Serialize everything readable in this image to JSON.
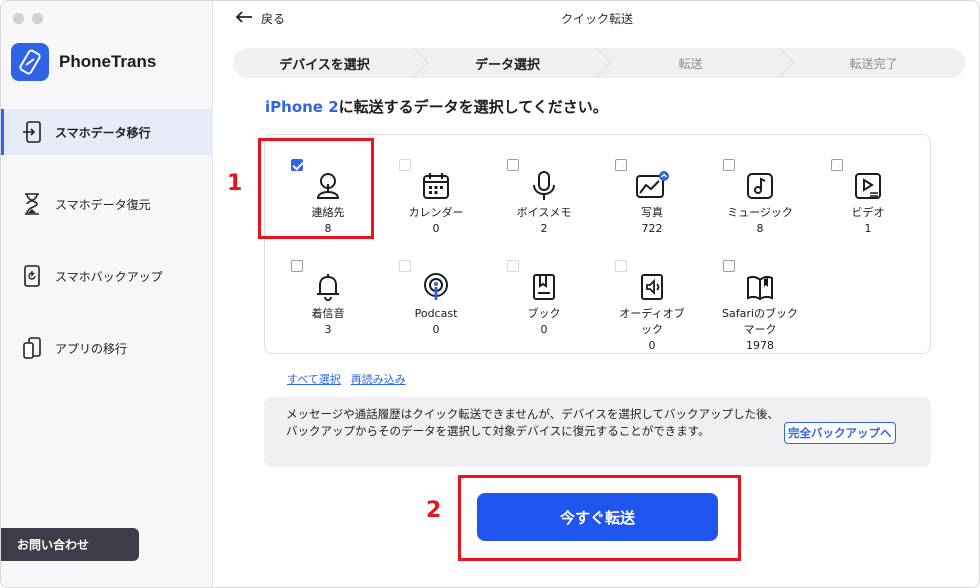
{
  "app": {
    "name": "PhoneTrans"
  },
  "sidebar": {
    "items": [
      {
        "label": "スマホデータ移行",
        "icon": "phone-transfer-icon",
        "active": true
      },
      {
        "label": "スマホデータ復元",
        "icon": "hourglass-icon",
        "active": false
      },
      {
        "label": "スマホバックアップ",
        "icon": "phone-backup-icon",
        "active": false
      },
      {
        "label": "アプリの移行",
        "icon": "app-transfer-icon",
        "active": false
      }
    ],
    "contact_label": "お問い合わせ"
  },
  "topbar": {
    "back_label": "戻る",
    "title": "クイック転送"
  },
  "steps": [
    {
      "label": "デバイスを選択",
      "state": "done"
    },
    {
      "label": "データ選択",
      "state": "done"
    },
    {
      "label": "転送",
      "state": "todo"
    },
    {
      "label": "転送完了",
      "state": "todo"
    }
  ],
  "headline": {
    "device": "iPhone 2",
    "text": "に転送するデータを選択してください。"
  },
  "categories": [
    {
      "label": "連絡先",
      "count": "8",
      "icon": "contacts-icon",
      "checked": true
    },
    {
      "label": "カレンダー",
      "count": "0",
      "icon": "calendar-icon",
      "checked": false
    },
    {
      "label": "ボイスメモ",
      "count": "2",
      "icon": "microphone-icon",
      "checked": false
    },
    {
      "label": "写真",
      "count": "722",
      "icon": "photos-icon",
      "checked": false
    },
    {
      "label": "ミュージック",
      "count": "8",
      "icon": "music-icon",
      "checked": false
    },
    {
      "label": "ビデオ",
      "count": "1",
      "icon": "video-icon",
      "checked": false
    },
    {
      "label": "着信音",
      "count": "3",
      "icon": "bell-icon",
      "checked": false
    },
    {
      "label": "Podcast",
      "count": "0",
      "icon": "podcast-icon",
      "checked": false
    },
    {
      "label": "ブック",
      "count": "0",
      "icon": "book-icon",
      "checked": false
    },
    {
      "label": "オーディオブック",
      "count": "0",
      "icon": "audiobook-icon",
      "checked": false
    },
    {
      "label": "Safariのブックマーク",
      "count": "1978",
      "icon": "safari-bookmark-icon",
      "checked": false
    }
  ],
  "links": {
    "select_all": "すべて選択",
    "reload": "再読み込み"
  },
  "notice": {
    "text": "メッセージや通話履歴はクイック転送できませんが、デバイスを選択してバックアップした後、バックアップからそのデータを選択して対象デバイスに復元することができます。",
    "button_label": "完全バックアップへ"
  },
  "primary_button": {
    "label": "今すぐ転送"
  },
  "annotations": {
    "marker_1": "1",
    "marker_2": "2"
  },
  "colors": {
    "accent": "#2f64e8",
    "annotation": "#e8131b"
  }
}
